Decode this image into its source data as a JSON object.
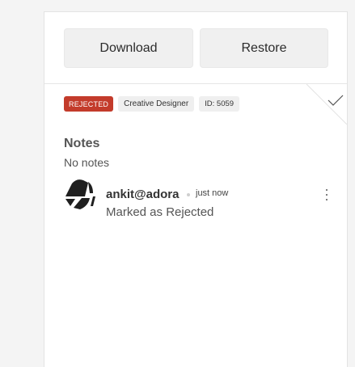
{
  "actions": {
    "download_label": "Download",
    "restore_label": "Restore"
  },
  "candidate": {
    "status": "REJECTED",
    "role": "Creative Designer",
    "id_label": "ID: 5059"
  },
  "notes": {
    "label": "Notes",
    "value": "No notes"
  },
  "activity": [
    {
      "user": "ankit@adora",
      "time": "just now",
      "text": "Marked as Rejected"
    }
  ],
  "icons": {
    "corner": "check-icon",
    "avatar": "avatar-logo",
    "menu": "more-vertical-icon"
  },
  "colors": {
    "status_rejected": "#c33b2b",
    "button_bg": "#f0f0f0",
    "panel_bg": "#ffffff",
    "page_bg": "#f4f4f4"
  }
}
